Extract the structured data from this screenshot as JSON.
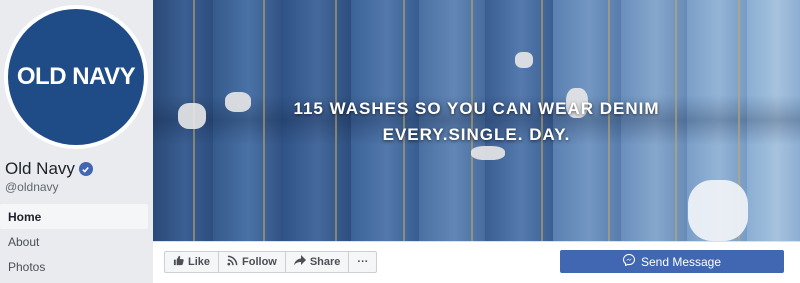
{
  "profile": {
    "logo_text": "OLD NAVY",
    "name": "Old Navy",
    "handle": "@oldnavy",
    "verified": true
  },
  "nav": {
    "items": [
      {
        "label": "Home",
        "active": true
      },
      {
        "label": "About",
        "active": false
      },
      {
        "label": "Photos",
        "active": false
      }
    ]
  },
  "cover": {
    "headline_line1": "115 WASHES SO YOU CAN WEAR DENIM",
    "headline_line2": "EVERY.SINGLE. DAY."
  },
  "actions": {
    "like_label": "Like",
    "follow_label": "Follow",
    "share_label": "Share",
    "more_label": "···",
    "send_message_label": "Send Message"
  },
  "colors": {
    "brand_navy": "#1f4b87",
    "facebook_blue": "#4267b2",
    "page_background": "#e9ebee"
  },
  "icons": [
    "verified-badge-icon",
    "like-thumb-icon",
    "follow-rss-icon",
    "share-arrow-icon",
    "more-dots-icon",
    "messenger-icon"
  ]
}
